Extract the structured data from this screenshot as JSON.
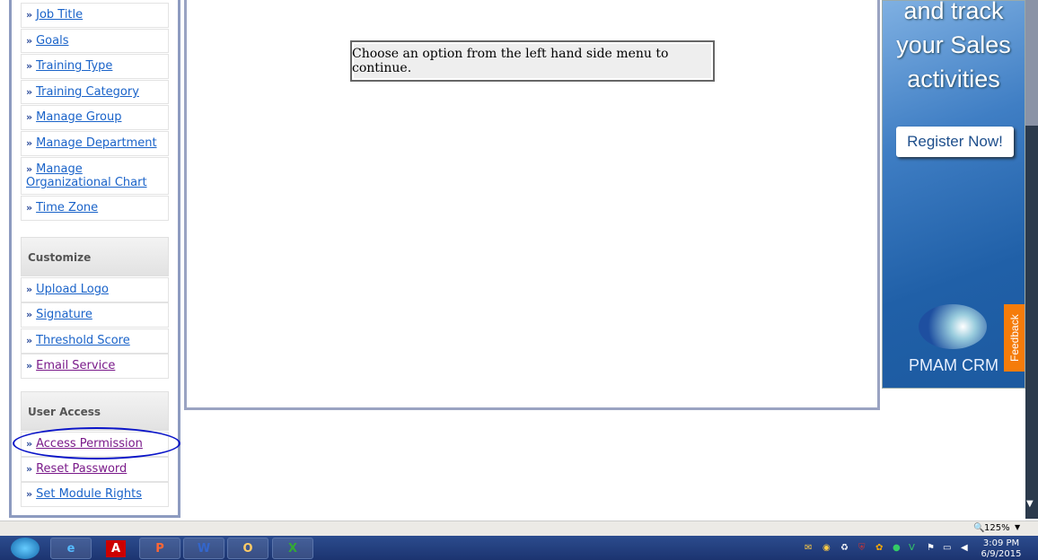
{
  "sidebar": {
    "items_a": [
      {
        "label": "Job Title",
        "visited": false
      },
      {
        "label": "Goals",
        "visited": false
      },
      {
        "label": "Training Type",
        "visited": false
      },
      {
        "label": "Training Category",
        "visited": false
      },
      {
        "label": "Manage Group",
        "visited": false
      },
      {
        "label": "Manage Department",
        "visited": false
      },
      {
        "label": "Manage Organizational Chart",
        "visited": false
      },
      {
        "label": "Time Zone",
        "visited": false
      }
    ],
    "customize": {
      "title": "Customize",
      "items": [
        {
          "label": "Upload Logo"
        },
        {
          "label": "Signature"
        },
        {
          "label": "Threshold Score"
        },
        {
          "label": "Email Service"
        }
      ]
    },
    "user_access": {
      "title": "User Access",
      "items": [
        {
          "label": "Access Permission"
        },
        {
          "label": "Reset Password"
        },
        {
          "label": "Set Module Rights"
        }
      ]
    },
    "bullet": "»"
  },
  "main": {
    "message": "Choose an option from the left hand side menu to continue."
  },
  "ad": {
    "lines": [
      "and track",
      "your Sales",
      "activities"
    ],
    "button": "Register Now!",
    "brand": "PMAM CRM",
    "feedback": "Feedback"
  },
  "status": {
    "zoom": "125%"
  },
  "taskbar": {
    "time": "3:09 PM",
    "date": "6/9/2015"
  },
  "colors": {
    "link": "#1a63c9",
    "visited": "#7a1a8a",
    "highlight_circle": "#0a14c8",
    "feedback": "#f57c0a"
  }
}
